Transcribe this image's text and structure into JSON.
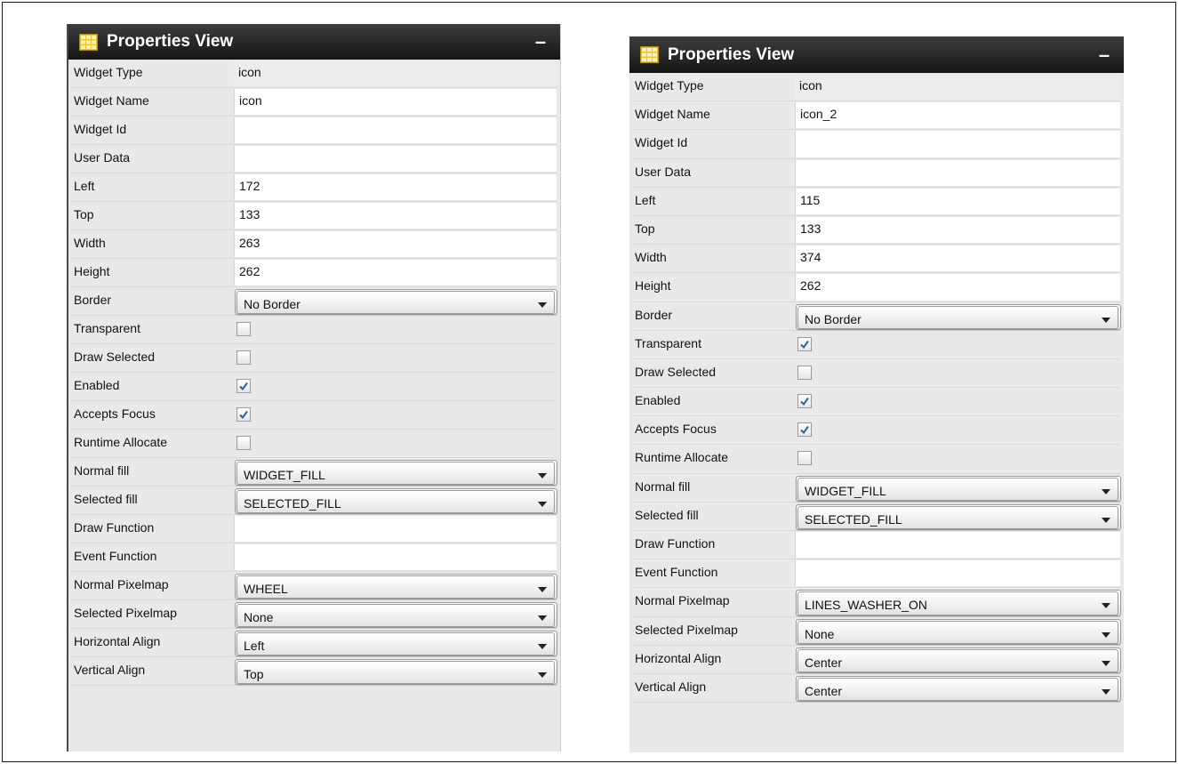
{
  "icons": {
    "panel_icon": "grid-icon",
    "minimize_icon": "minimize-icon",
    "dropdown_icon": "chevron-down-icon",
    "checkmark": "check-icon"
  },
  "colors": {
    "titlebar_dark": "#151515",
    "title_text": "#ffffff",
    "check_blue": "#2a5db0",
    "grid_icon_yellow": "#f3c22a"
  },
  "panels": [
    {
      "title": "Properties View",
      "minimize": "–",
      "rows": [
        {
          "label": "Widget Type",
          "type": "plain",
          "value": "icon"
        },
        {
          "label": "Widget Name",
          "type": "text",
          "value": "icon"
        },
        {
          "label": "Widget Id",
          "type": "text",
          "value": ""
        },
        {
          "label": "User Data",
          "type": "text",
          "value": ""
        },
        {
          "label": "Left",
          "type": "text",
          "value": "172"
        },
        {
          "label": "Top",
          "type": "text",
          "value": "133"
        },
        {
          "label": "Width",
          "type": "text",
          "value": "263"
        },
        {
          "label": "Height",
          "type": "text",
          "value": "262"
        },
        {
          "label": "Border",
          "type": "select",
          "value": "No Border"
        },
        {
          "label": "Transparent",
          "type": "check",
          "checked": false
        },
        {
          "label": "Draw Selected",
          "type": "check",
          "checked": false
        },
        {
          "label": "Enabled",
          "type": "check",
          "checked": true
        },
        {
          "label": "Accepts Focus",
          "type": "check",
          "checked": true
        },
        {
          "label": "Runtime Allocate",
          "type": "check",
          "checked": false
        },
        {
          "label": "Normal fill",
          "type": "select",
          "value": "WIDGET_FILL"
        },
        {
          "label": "Selected fill",
          "type": "select",
          "value": "SELECTED_FILL"
        },
        {
          "label": "Draw Function",
          "type": "text",
          "value": ""
        },
        {
          "label": "Event Function",
          "type": "text",
          "value": ""
        },
        {
          "label": "Normal Pixelmap",
          "type": "select",
          "value": "WHEEL"
        },
        {
          "label": "Selected Pixelmap",
          "type": "select",
          "value": "None"
        },
        {
          "label": "Horizontal Align",
          "type": "select",
          "value": "Left"
        },
        {
          "label": "Vertical Align",
          "type": "select",
          "value": "Top"
        }
      ]
    },
    {
      "title": "Properties View",
      "minimize": "–",
      "rows": [
        {
          "label": "Widget Type",
          "type": "plain",
          "value": "icon"
        },
        {
          "label": "Widget Name",
          "type": "text",
          "value": "icon_2"
        },
        {
          "label": "Widget Id",
          "type": "text",
          "value": ""
        },
        {
          "label": "User Data",
          "type": "text",
          "value": ""
        },
        {
          "label": "Left",
          "type": "text",
          "value": "115"
        },
        {
          "label": "Top",
          "type": "text",
          "value": "133"
        },
        {
          "label": "Width",
          "type": "text",
          "value": "374"
        },
        {
          "label": "Height",
          "type": "text",
          "value": "262"
        },
        {
          "label": "Border",
          "type": "select",
          "value": "No Border"
        },
        {
          "label": "Transparent",
          "type": "check",
          "checked": true
        },
        {
          "label": "Draw Selected",
          "type": "check",
          "checked": false
        },
        {
          "label": "Enabled",
          "type": "check",
          "checked": true
        },
        {
          "label": "Accepts Focus",
          "type": "check",
          "checked": true
        },
        {
          "label": "Runtime Allocate",
          "type": "check",
          "checked": false
        },
        {
          "label": "Normal fill",
          "type": "select",
          "value": "WIDGET_FILL"
        },
        {
          "label": "Selected fill",
          "type": "select",
          "value": "SELECTED_FILL"
        },
        {
          "label": "Draw Function",
          "type": "text",
          "value": ""
        },
        {
          "label": "Event Function",
          "type": "text",
          "value": ""
        },
        {
          "label": "Normal Pixelmap",
          "type": "select",
          "value": "LINES_WASHER_ON"
        },
        {
          "label": "Selected Pixelmap",
          "type": "select",
          "value": "None"
        },
        {
          "label": "Horizontal Align",
          "type": "select",
          "value": "Center"
        },
        {
          "label": "Vertical Align",
          "type": "select",
          "value": "Center"
        }
      ]
    }
  ]
}
